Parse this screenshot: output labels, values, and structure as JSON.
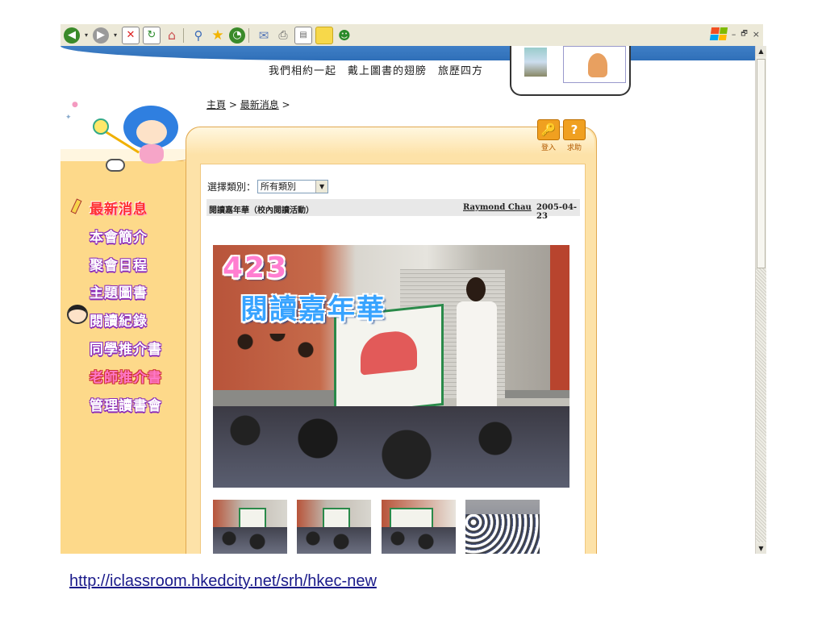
{
  "browser": {
    "toolbar_icons": [
      "back-icon",
      "forward-icon",
      "stop-icon",
      "refresh-icon",
      "home-icon",
      "search-icon",
      "favorites-icon",
      "history-icon",
      "mail-icon",
      "print-icon",
      "edit-icon",
      "folder-icon",
      "messenger-icon"
    ],
    "window_controls": {
      "minimize": "–",
      "restore": "🗗",
      "close": "×"
    }
  },
  "header": {
    "slogan": "我們相約一起　戴上圖書的翅膀　旅歷四方"
  },
  "breadcrumb": {
    "home": "主頁",
    "sep1": " > ",
    "news": "最新消息",
    "sep2": " >"
  },
  "top_actions": {
    "login_label": "登入",
    "help_label": "求助",
    "login_glyph": "🔑",
    "help_glyph": "?"
  },
  "nav": {
    "items": [
      {
        "label": "最新消息",
        "style": "red"
      },
      {
        "label": "本會簡介",
        "style": "purple"
      },
      {
        "label": "聚會日程",
        "style": "purple"
      },
      {
        "label": "主題圖書",
        "style": "purple"
      },
      {
        "label": "閱讀紀錄",
        "style": "purple"
      },
      {
        "label": "同學推介書",
        "style": "purple"
      },
      {
        "label": "老師推介書",
        "style": "pink"
      },
      {
        "label": "管理讀書會",
        "style": "purple"
      }
    ]
  },
  "filter": {
    "label": "選擇類別：",
    "selected": "所有類別",
    "arrow": "▼"
  },
  "entry": {
    "title": "閱讀嘉年華（校內閱讀活動）",
    "author": "Raymond Chau",
    "date": "2005-04-23"
  },
  "photo": {
    "overlay_line1": "423",
    "overlay_line2": "閱讀嘉年華"
  },
  "thumbnails_count": 4,
  "footer": {
    "url": "http://iclassroom.hkedcity.net/srh/hkec-new"
  },
  "colors": {
    "sidebar": "#fdd98a",
    "frame": "#fde2a8",
    "accent_orange": "#f0a020",
    "toolbar": "#ece9d8"
  }
}
